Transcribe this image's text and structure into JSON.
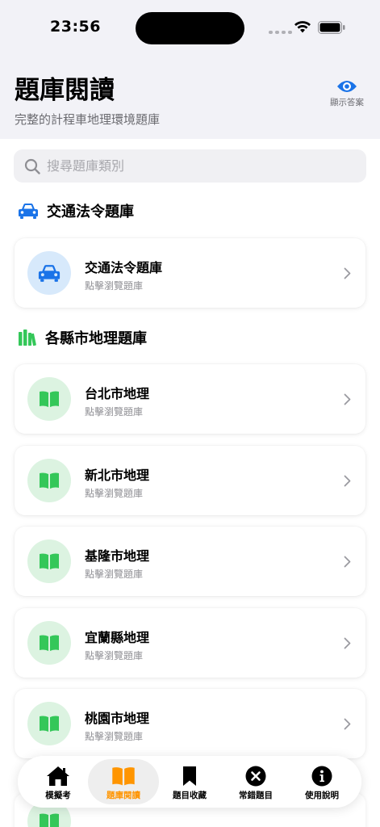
{
  "status_bar": {
    "time": "23:56"
  },
  "header": {
    "title": "題庫閱讀",
    "subtitle": "完整的計程車地理環境題庫",
    "reveal_answer_label": "顯示答案"
  },
  "search": {
    "placeholder": "搜尋題庫類別",
    "value": ""
  },
  "sections": [
    {
      "title": "交通法令題庫",
      "icon": "car-icon",
      "items": [
        {
          "title": "交通法令題庫",
          "subtitle": "點擊瀏覽題庫",
          "icon": "car-icon"
        }
      ]
    },
    {
      "title": "各縣市地理題庫",
      "icon": "books-icon",
      "items": [
        {
          "title": "台北市地理",
          "subtitle": "點擊瀏覽題庫",
          "icon": "book-icon"
        },
        {
          "title": "新北市地理",
          "subtitle": "點擊瀏覽題庫",
          "icon": "book-icon"
        },
        {
          "title": "基隆市地理",
          "subtitle": "點擊瀏覽題庫",
          "icon": "book-icon"
        },
        {
          "title": "宜蘭縣地理",
          "subtitle": "點擊瀏覽題庫",
          "icon": "book-icon"
        },
        {
          "title": "桃園市地理",
          "subtitle": "點擊瀏覽題庫",
          "icon": "book-icon"
        }
      ]
    }
  ],
  "tabbar": {
    "active_index": 1,
    "items": [
      {
        "label": "模擬考",
        "icon": "house-icon"
      },
      {
        "label": "題庫閱讀",
        "icon": "book-open-icon"
      },
      {
        "label": "題目收藏",
        "icon": "bookmark-icon"
      },
      {
        "label": "常錯題目",
        "icon": "x-circle-icon"
      },
      {
        "label": "使用說明",
        "icon": "info-circle-icon"
      }
    ]
  },
  "colors": {
    "accent_blue": "#1a73e8",
    "accent_green": "#34c759",
    "accent_orange": "#ff9500",
    "background_gray": "#f2f2f7"
  }
}
